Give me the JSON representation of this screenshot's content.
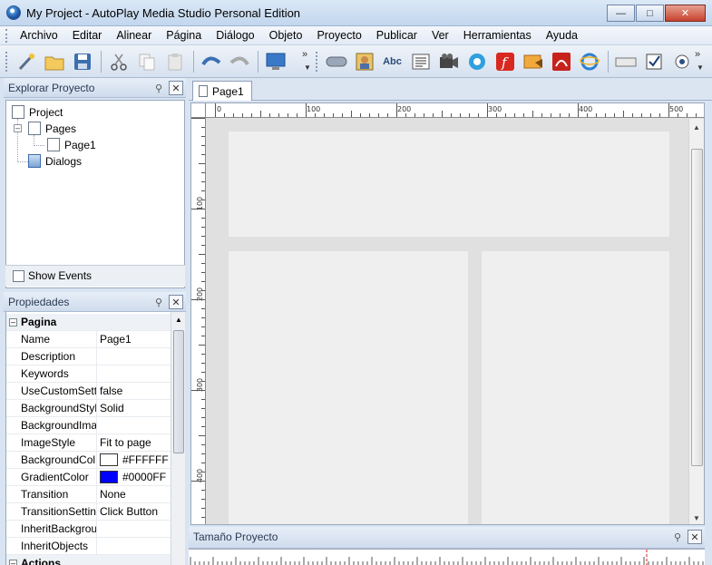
{
  "window": {
    "title": "My Project - AutoPlay Media Studio Personal Edition"
  },
  "menu": [
    "Archivo",
    "Editar",
    "Alinear",
    "Página",
    "Diálogo",
    "Objeto",
    "Proyecto",
    "Publicar",
    "Ver",
    "Herramientas",
    "Ayuda"
  ],
  "toolbar": {
    "buttons": [
      "wizard-icon",
      "open-folder-icon",
      "save-icon",
      "cut-icon",
      "copy-icon",
      "paste-icon",
      "undo-icon",
      "redo-icon",
      "preview-icon"
    ],
    "objects": [
      "button-object-icon",
      "image-object-icon",
      "label-object-icon",
      "paragraph-object-icon",
      "video-object-icon",
      "quicktime-object-icon",
      "flash-object-icon",
      "slideshow-object-icon",
      "pdf-object-icon",
      "web-object-icon",
      "input-object-icon",
      "checkbox-object-icon",
      "radio-object-icon"
    ],
    "label_button_text": "Abc"
  },
  "explorer": {
    "title": "Explorar Proyecto",
    "root": "Project",
    "pages_label": "Pages",
    "page1": "Page1",
    "dialogs_label": "Dialogs",
    "show_events": "Show Events"
  },
  "properties": {
    "title": "Propiedades",
    "category": "Pagina",
    "rows": [
      {
        "name": "Name",
        "value": "Page1"
      },
      {
        "name": "Description",
        "value": ""
      },
      {
        "name": "Keywords",
        "value": ""
      },
      {
        "name": "UseCustomSett",
        "value": "false"
      },
      {
        "name": "BackgroundStyl",
        "value": "Solid"
      },
      {
        "name": "BackgroundIma",
        "value": ""
      },
      {
        "name": "ImageStyle",
        "value": "Fit to page"
      },
      {
        "name": "BackgroundCol",
        "value": "#FFFFFF",
        "swatch": "#FFFFFF"
      },
      {
        "name": "GradientColor",
        "value": "#0000FF",
        "swatch": "#0000FF"
      },
      {
        "name": "Transition",
        "value": "None"
      },
      {
        "name": "TransitionSettin",
        "value": "Click Button"
      },
      {
        "name": "InheritBackgrou",
        "value": ""
      },
      {
        "name": "InheritObjects",
        "value": ""
      }
    ],
    "next_category": "Actions"
  },
  "document": {
    "tab": "Page1",
    "ruler_h": [
      "0",
      "100",
      "200",
      "300",
      "400",
      "500"
    ],
    "ruler_v": [
      "100",
      "200",
      "300",
      "400"
    ]
  },
  "bottom_panel": {
    "title": "Tamaño Proyecto"
  }
}
